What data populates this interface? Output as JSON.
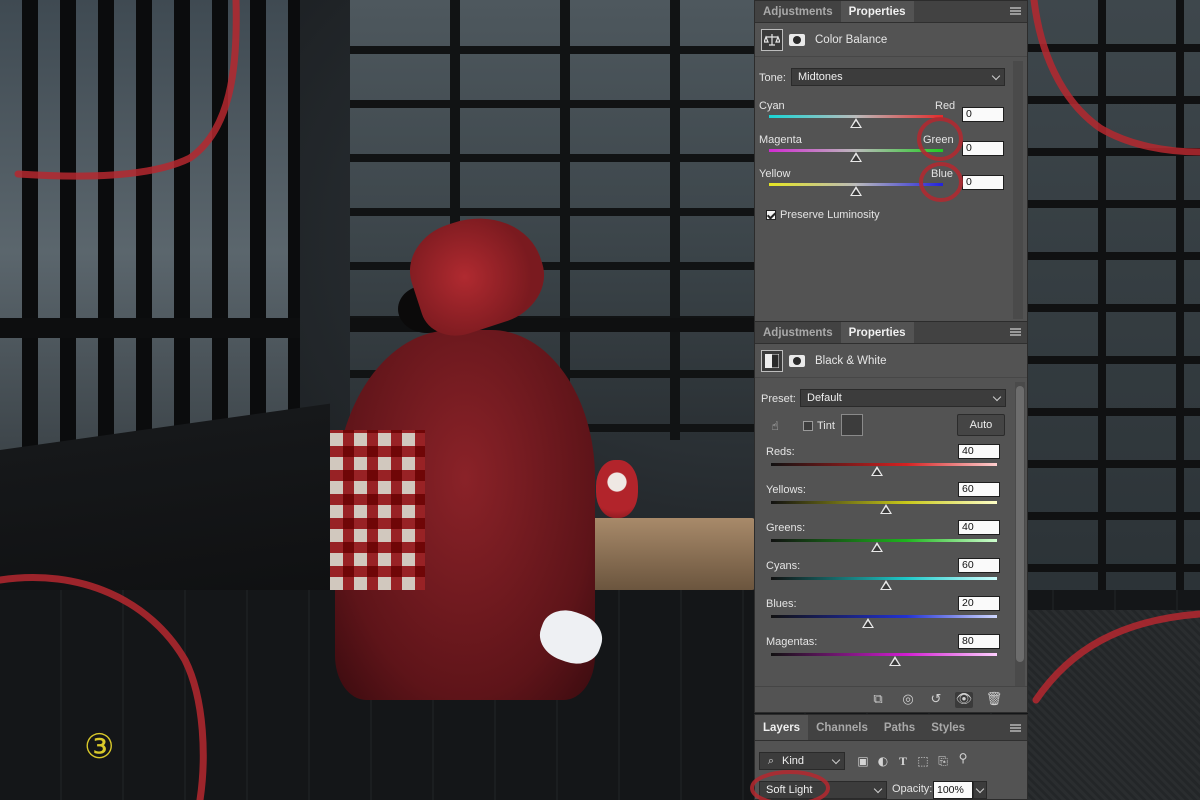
{
  "overlay": {
    "step_marker": "③"
  },
  "color_balance_panel": {
    "tabs": [
      "Adjustments",
      "Properties"
    ],
    "title": "Color Balance",
    "tone_label": "Tone:",
    "tone_value": "Midtones",
    "sliders": [
      {
        "left": "Cyan",
        "right": "Red",
        "value": "0",
        "level": 0.5
      },
      {
        "left": "Magenta",
        "right": "Green",
        "value": "0",
        "level": 0.5
      },
      {
        "left": "Yellow",
        "right": "Blue",
        "value": "0",
        "level": 0.5
      }
    ],
    "preserve_luminosity": "Preserve Luminosity"
  },
  "black_white_panel": {
    "tabs": [
      "Adjustments",
      "Properties"
    ],
    "title": "Black & White",
    "preset_label": "Preset:",
    "preset_value": "Default",
    "tint_label": "Tint",
    "auto_label": "Auto",
    "sliders": [
      {
        "label": "Reds:",
        "value": "40",
        "level": 0.47
      },
      {
        "label": "Yellows:",
        "value": "60",
        "level": 0.51
      },
      {
        "label": "Greens:",
        "value": "40",
        "level": 0.47
      },
      {
        "label": "Cyans:",
        "value": "60",
        "level": 0.51
      },
      {
        "label": "Blues:",
        "value": "20",
        "level": 0.43
      },
      {
        "label": "Magentas:",
        "value": "80",
        "level": 0.55
      }
    ]
  },
  "layers_panel": {
    "tabs": [
      "Layers",
      "Channels",
      "Paths",
      "Styles"
    ],
    "filter_value": "Kind",
    "blend_mode": "Soft Light",
    "opacity_label": "Opacity:",
    "opacity_value": "100%"
  },
  "colors": {
    "panel_bg": "#535353",
    "annotation_red": "#b5282f",
    "step_marker": "#d9c92a"
  }
}
